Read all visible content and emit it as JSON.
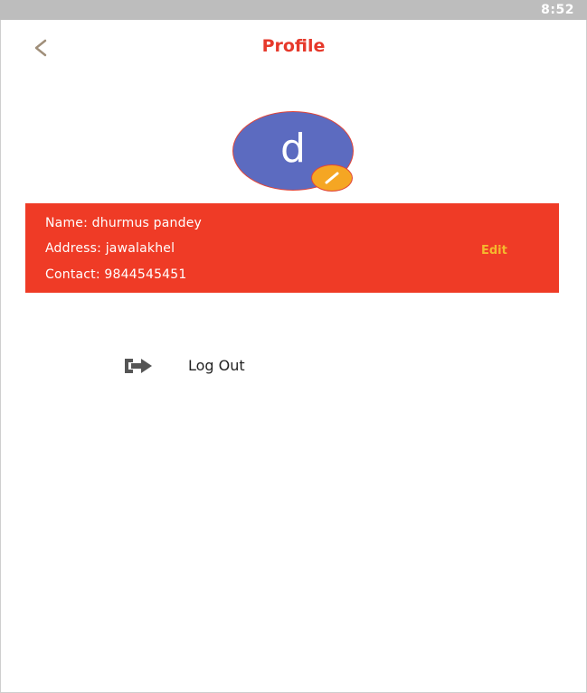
{
  "status_bar": {
    "time": "8:52"
  },
  "header": {
    "title": "Profile",
    "back_icon": "chevron-left-icon",
    "title_color": "#e6392b"
  },
  "avatar": {
    "letter": "d",
    "background_color": "#5c6bc0",
    "edit_icon": "pencil-icon",
    "edit_badge_color": "#f5a623"
  },
  "profile_card": {
    "background_color": "#ef3b26",
    "name_line": "Name: dhurmus pandey",
    "address_line": "Address: jawalakhel",
    "contact_line": "Contact: 9844545451",
    "edit_label": "Edit"
  },
  "actions": {
    "logout_label": "Log Out",
    "logout_icon": "logout-icon"
  }
}
